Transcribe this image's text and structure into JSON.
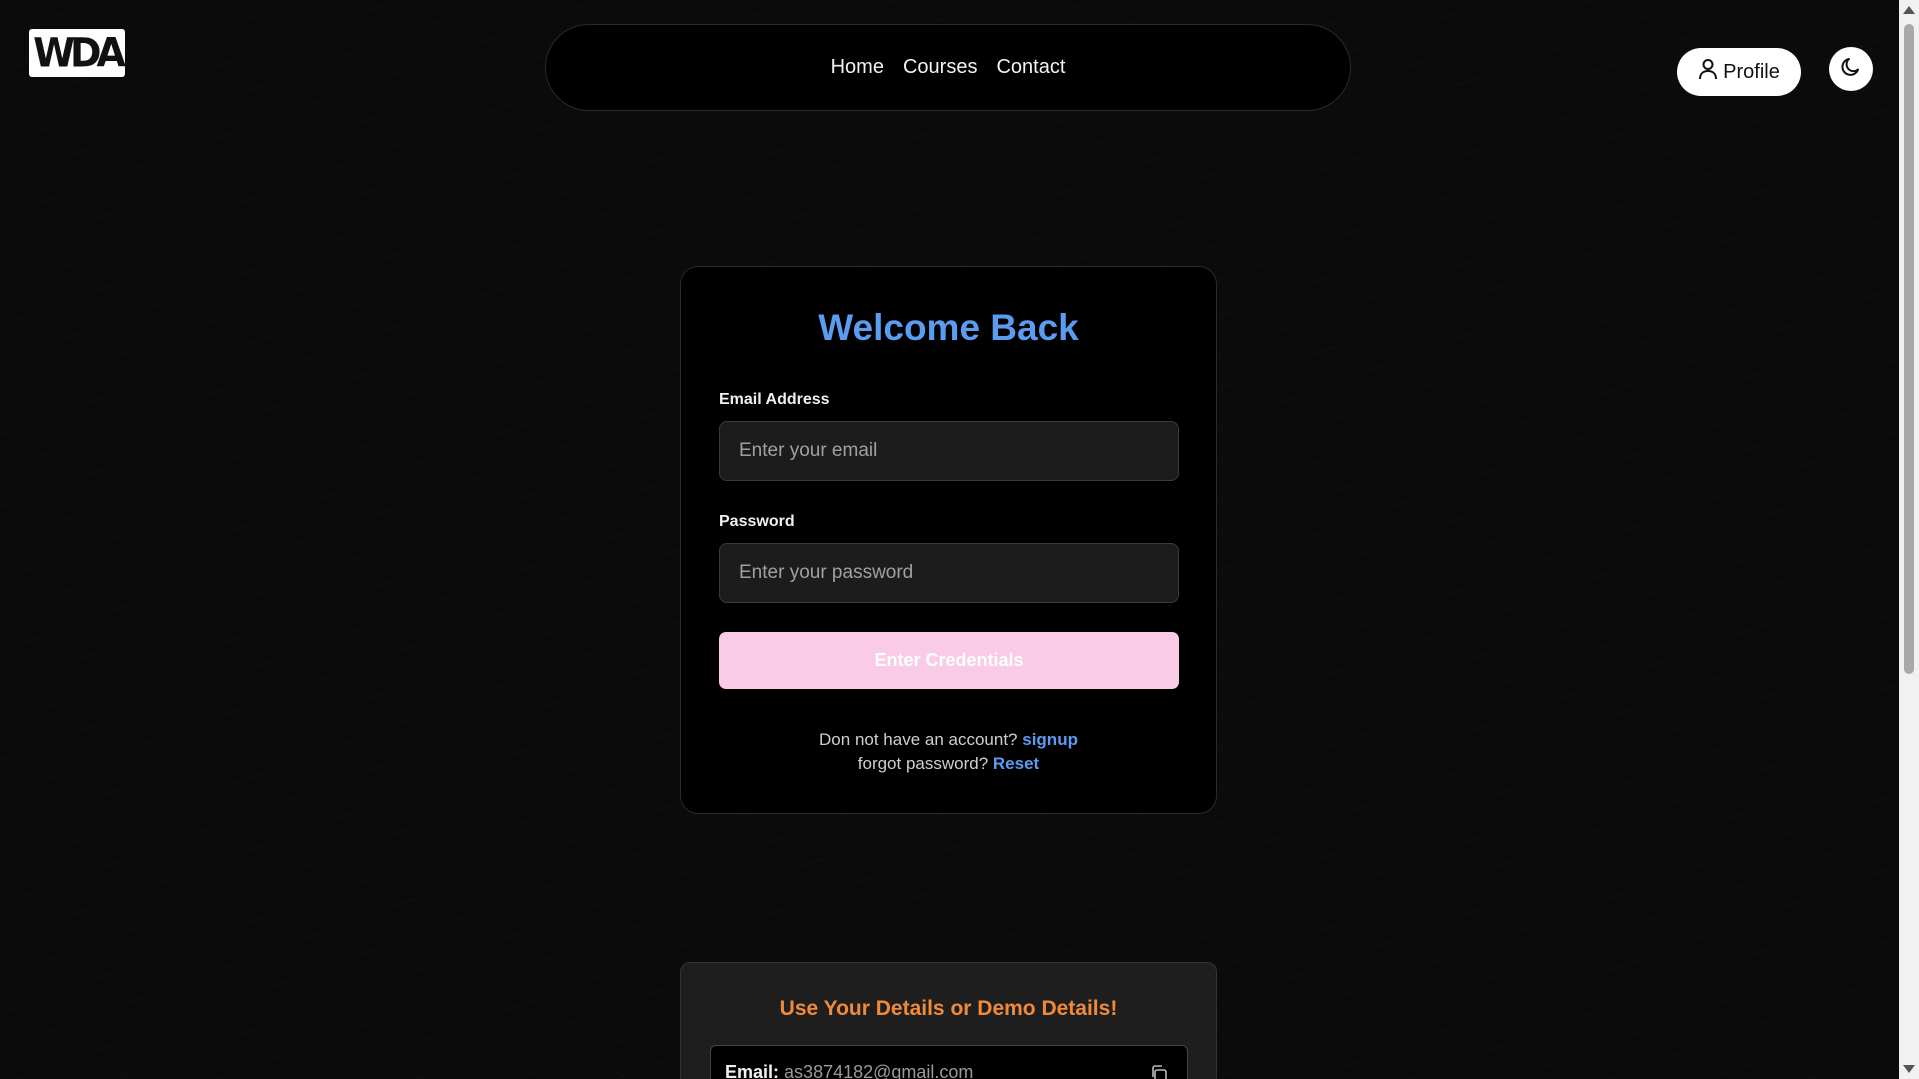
{
  "logo": {
    "text": "WDA"
  },
  "nav": {
    "items": [
      {
        "label": "Home"
      },
      {
        "label": "Courses"
      },
      {
        "label": "Contact"
      }
    ]
  },
  "header": {
    "profile_label": "Profile",
    "profile_icon": "user-icon",
    "theme_icon": "moon-icon"
  },
  "login": {
    "title": "Welcome Back",
    "email_label": "Email Address",
    "email_placeholder": "Enter your email",
    "email_value": "",
    "password_label": "Password",
    "password_placeholder": "Enter your password",
    "password_value": "",
    "submit_label": "Enter Credentials",
    "signup_prompt": "Don not have an account?",
    "signup_link": "signup",
    "forgot_prompt": "forgot password?",
    "reset_link": "Reset"
  },
  "demo": {
    "title": "Use Your Details or Demo Details!",
    "email_key": "Email:",
    "email_value": "as3874182@gmail.com",
    "copy_icon": "copy-icon"
  },
  "colors": {
    "accent_blue": "#5b9bf0",
    "button_pink": "#f9cbe6",
    "demo_orange": "#f08a3a",
    "background": "#0b0b0b"
  }
}
